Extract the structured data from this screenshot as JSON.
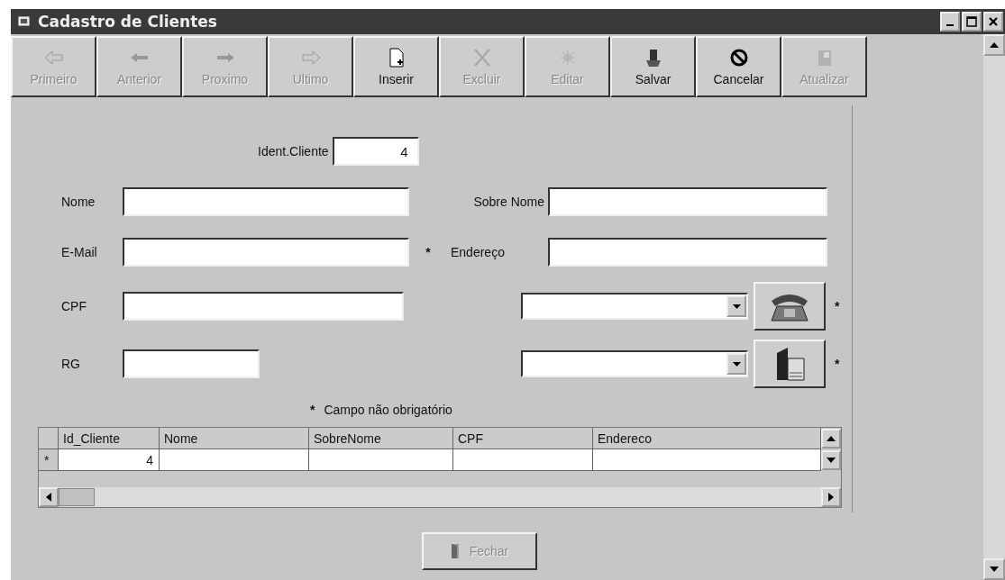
{
  "window": {
    "title": "Cadastro de Clientes"
  },
  "toolbar": [
    {
      "label": "Primeiro",
      "kind": "first",
      "disabled": true
    },
    {
      "label": "Anterior",
      "kind": "prev",
      "disabled": true
    },
    {
      "label": "Proximo",
      "kind": "next",
      "disabled": true
    },
    {
      "label": "Ultimo",
      "kind": "last",
      "disabled": true
    },
    {
      "label": "Inserir",
      "kind": "insert",
      "disabled": false
    },
    {
      "label": "Excluir",
      "kind": "delete",
      "disabled": true
    },
    {
      "label": "Editar",
      "kind": "edit",
      "disabled": true
    },
    {
      "label": "Salvar",
      "kind": "save",
      "disabled": false
    },
    {
      "label": "Cancelar",
      "kind": "cancel",
      "disabled": false
    },
    {
      "label": "Atualizar",
      "kind": "refresh",
      "disabled": true
    }
  ],
  "form": {
    "ident": {
      "label": "Ident.Cliente",
      "value": "4"
    },
    "nome": {
      "label": "Nome"
    },
    "sobre_nome": {
      "label": "Sobre Nome"
    },
    "email": {
      "label": "E-Mail",
      "marker": "*"
    },
    "endereco": {
      "label": "Endereço"
    },
    "cpf": {
      "label": "CPF"
    },
    "rg": {
      "label": "RG"
    },
    "phone": {
      "marker": "*"
    },
    "book": {
      "marker": "*"
    },
    "note": {
      "marker": "*",
      "text": "Campo não obrigatório"
    }
  },
  "grid": {
    "columns": [
      "Id_Cliente",
      "Nome",
      "SobreNome",
      "CPF",
      "Endereco"
    ],
    "rows": [
      {
        "indicator": "*",
        "id_cliente": "4"
      }
    ]
  },
  "close_button": {
    "label": "Fechar",
    "disabled": true
  }
}
